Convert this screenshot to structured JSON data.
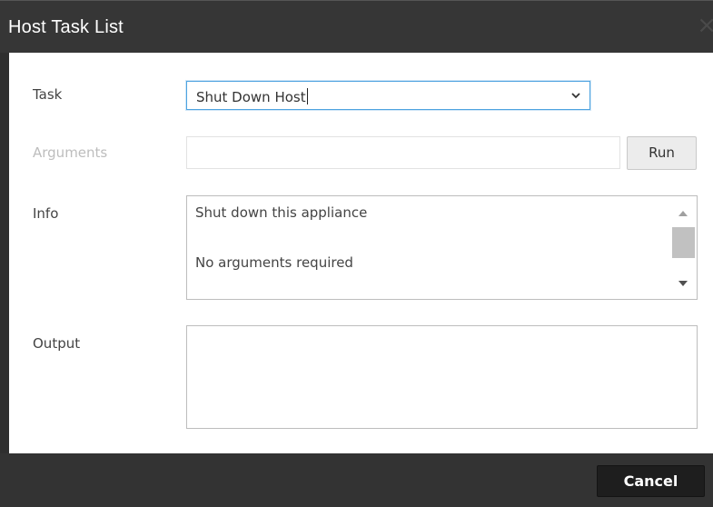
{
  "dialog": {
    "title": "Host Task List",
    "close_label": "×"
  },
  "task": {
    "label": "Task",
    "selected": "Shut Down Host"
  },
  "arguments": {
    "label": "Arguments",
    "value": "",
    "run_label": "Run"
  },
  "info": {
    "label": "Info",
    "lines": [
      "Shut down this appliance",
      "No arguments required"
    ]
  },
  "output": {
    "label": "Output",
    "value": ""
  },
  "footer": {
    "cancel_label": "Cancel"
  }
}
